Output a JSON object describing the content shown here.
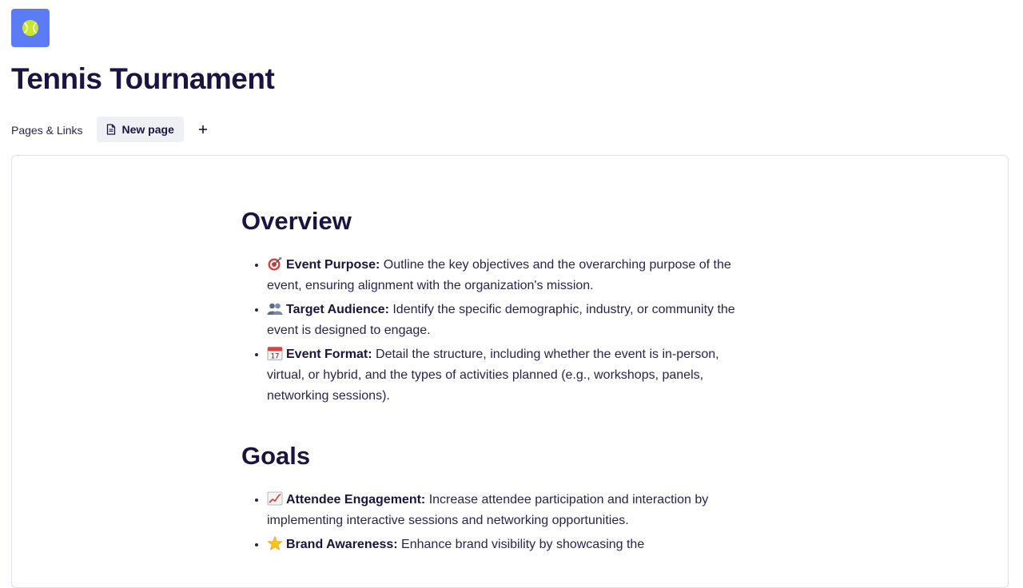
{
  "page": {
    "icon": "tennis-ball-icon",
    "title": "Tennis Tournament"
  },
  "links_bar": {
    "label": "Pages & Links",
    "new_page_label": "New page",
    "add_icon": "plus-icon"
  },
  "sections": [
    {
      "heading": "Overview",
      "items": [
        {
          "icon": "target-icon",
          "title": "Event Purpose:",
          "text": " Outline the key objectives and the overarching purpose of the event, ensuring alignment with the organization's mission."
        },
        {
          "icon": "people-icon",
          "title": "Target Audience:",
          "text": " Identify the specific demographic, industry, or community the event is designed to engage."
        },
        {
          "icon": "calendar-icon",
          "title": "Event Format:",
          "text": " Detail the structure, including whether the event is in-person, virtual, or hybrid, and the types of activities planned (e.g., workshops, panels, networking sessions)."
        }
      ]
    },
    {
      "heading": "Goals",
      "items": [
        {
          "icon": "chart-increasing-icon",
          "title": "Attendee Engagement:",
          "text": " Increase attendee participation and interaction by implementing interactive sessions and networking opportunities."
        },
        {
          "icon": "star-icon",
          "title": "Brand Awareness:",
          "text": " Enhance brand visibility by showcasing the"
        }
      ]
    }
  ],
  "colors": {
    "icon_bg": "#5b7cf5",
    "title": "#1b1340",
    "chip_bg": "#eef0f4"
  }
}
